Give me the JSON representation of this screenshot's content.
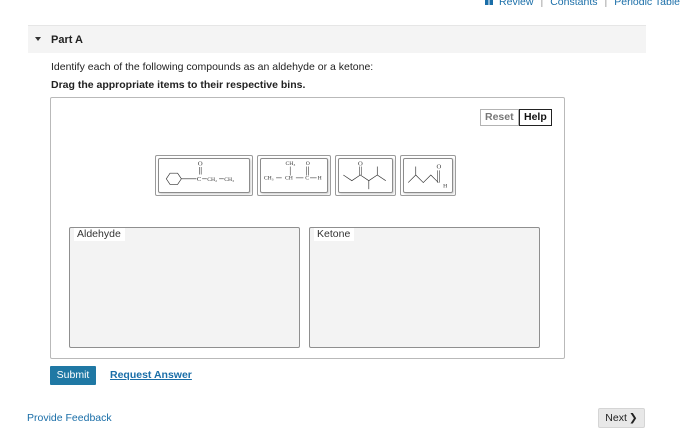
{
  "top_links": {
    "review": "Review",
    "constants": "Constants",
    "periodic_table": "Periodic Table",
    "separator": "|"
  },
  "part": {
    "title": "Part A"
  },
  "instructions": {
    "line1": "Identify each of the following compounds as an aldehyde or a ketone:",
    "line2": "Drag the appropriate items to their respective bins."
  },
  "buttons": {
    "reset": "Reset",
    "help": "Help",
    "submit": "Submit",
    "request_answer": "Request Answer",
    "next": "Next",
    "next_chevron": "❯"
  },
  "feedback": "Provide Feedback",
  "bins": [
    {
      "label": "Aldehyde"
    },
    {
      "label": "Ketone"
    }
  ],
  "compounds": [
    {
      "name": "cyclohexyl-ketone",
      "label_o": "O",
      "label_c": "C",
      "label_ch2": "CH₂",
      "label_ch3": "CH₃"
    },
    {
      "name": "2-methylpropanal",
      "label_ch3_top": "CH₃",
      "label_o": "O",
      "label_ch3": "CH₃",
      "label_ch": "CH",
      "label_c": "C",
      "label_h": "H"
    },
    {
      "name": "skeletal-ketone",
      "label_o": "O"
    },
    {
      "name": "skeletal-aldehyde",
      "label_o": "O",
      "label_h": "H"
    }
  ],
  "colors": {
    "accent": "#1f78a4",
    "link": "#1a6ea8"
  }
}
